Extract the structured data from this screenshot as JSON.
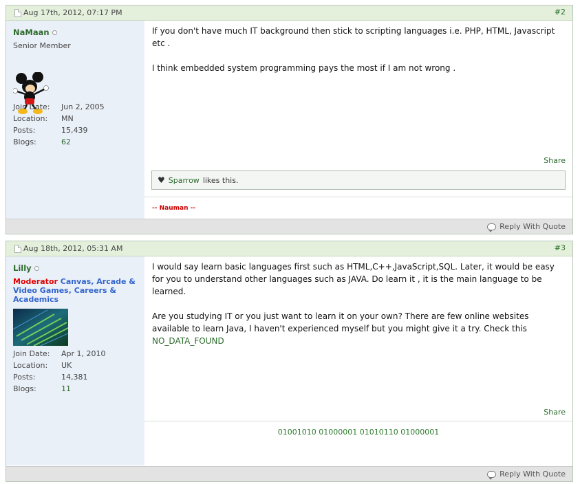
{
  "posts": [
    {
      "date": "Aug 17th, 2012, 07:17 PM",
      "number": "#2",
      "username": "NaMaan",
      "usertitle": "Senior Member",
      "stats": [
        {
          "label": "Join Date:",
          "value": "Jun 2, 2005"
        },
        {
          "label": "Location:",
          "value": "MN"
        },
        {
          "label": "Posts:",
          "value": "15,439"
        },
        {
          "label": "Blogs:",
          "value": "62"
        }
      ],
      "message": [
        "If you don't have much IT background then stick to scripting languages i.e. PHP, HTML, Javascript etc .",
        "I think embedded system programming pays the most if I am not wrong ."
      ],
      "share": "Share",
      "likes": {
        "user": "Sparrow",
        "text": "likes this."
      },
      "signature": "-- Nauman --",
      "reply": "Reply With Quote",
      "avatar": "mickey-mouse-avatar"
    },
    {
      "date": "Aug 18th, 2012, 05:31 AM",
      "number": "#3",
      "username": "Lilly",
      "rank_mod": "Moderator",
      "rank_groups": "Canvas, Arcade & Video Games, Careers & Academics",
      "stats": [
        {
          "label": "Join Date:",
          "value": "Apr 1, 2010"
        },
        {
          "label": "Location:",
          "value": "UK"
        },
        {
          "label": "Posts:",
          "value": "14,381"
        },
        {
          "label": "Blogs:",
          "value": "11"
        }
      ],
      "message": [
        "I would say learn basic languages first such as HTML,C++,JavaScript,SQL. Later, it would be easy for you to understand other languages such as JAVA. Do learn it , it is the main language to be learned.",
        "Are you studying IT or you just want to learn it on your own? There are few online websites available to learn Java, I haven't experienced myself but you might give it a try. Check this"
      ],
      "link": "NO_DATA_FOUND",
      "share": "Share",
      "signature": "01001010 01000001 01010110 01000001",
      "reply": "Reply With Quote",
      "avatar": "keyboard-avatar"
    }
  ]
}
